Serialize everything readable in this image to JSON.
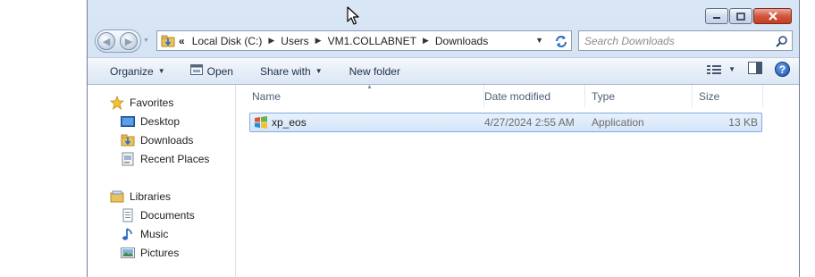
{
  "window": {
    "controls": {
      "minimize": "minimize",
      "maximize": "maximize",
      "close": "close"
    }
  },
  "address": {
    "overflow": "«",
    "crumbs": [
      "Local Disk (C:)",
      "Users",
      "VM1.COLLABNET",
      "Downloads"
    ]
  },
  "search": {
    "placeholder": "Search Downloads"
  },
  "toolbar": {
    "organize": "Organize",
    "open": "Open",
    "share_with": "Share with",
    "new_folder": "New folder",
    "help": "?"
  },
  "nav": {
    "favorites": "Favorites",
    "desktop": "Desktop",
    "downloads": "Downloads",
    "recent_places": "Recent Places",
    "libraries": "Libraries",
    "documents": "Documents",
    "music": "Music",
    "pictures": "Pictures"
  },
  "columns": {
    "name": "Name",
    "date": "Date modified",
    "type": "Type",
    "size": "Size"
  },
  "files": [
    {
      "name": "xp_eos",
      "date": "4/27/2024 2:55 AM",
      "type": "Application",
      "size": "13 KB"
    }
  ]
}
